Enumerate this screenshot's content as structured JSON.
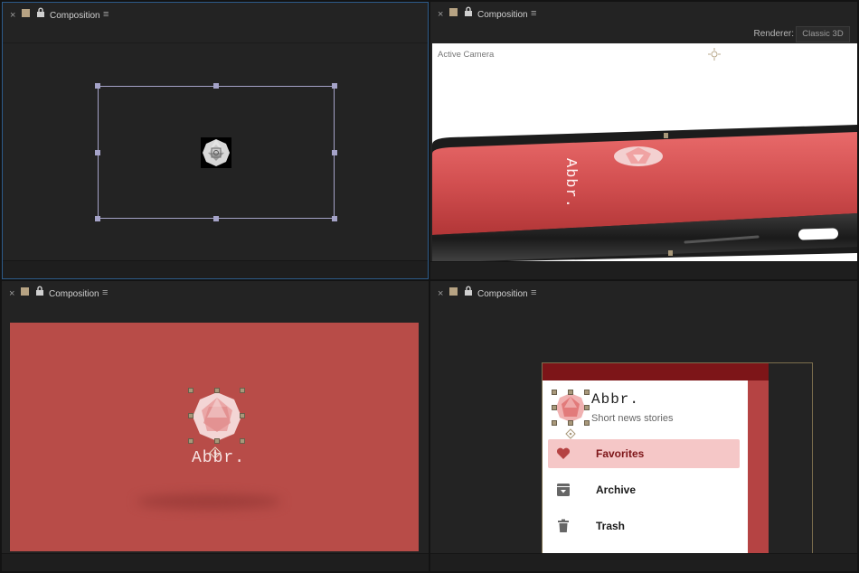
{
  "panels": [
    {
      "close_glyph": "×",
      "title": "Composition",
      "menu_glyph": "≡"
    },
    {
      "close_glyph": "×",
      "title": "Composition",
      "menu_glyph": "≡"
    },
    {
      "close_glyph": "×",
      "title": "Composition",
      "menu_glyph": "≡"
    },
    {
      "close_glyph": "×",
      "title": "Composition",
      "menu_glyph": "≡"
    }
  ],
  "renderer": {
    "label": "Renderer:",
    "value": "Classic 3D"
  },
  "viewport": {
    "camera_label": "Active Camera"
  },
  "logo": {
    "text": "Abbr."
  },
  "app": {
    "title": "Abbr.",
    "subtitle": "Short news stories",
    "menu": [
      {
        "label": "Favorites",
        "icon": "heart-icon",
        "selected": true
      },
      {
        "label": "Archive",
        "icon": "archive-icon",
        "selected": false
      },
      {
        "label": "Trash",
        "icon": "trash-icon",
        "selected": false
      }
    ]
  },
  "colors": {
    "panel_bg": "#232323",
    "active_border": "#2d5b8a",
    "brand_red": "#b84c48",
    "header_dark_red": "#7d1518",
    "selection_pink": "#f5c7c7",
    "handle_purple": "#a5a3c8",
    "handle_tan": "#a8987a"
  }
}
